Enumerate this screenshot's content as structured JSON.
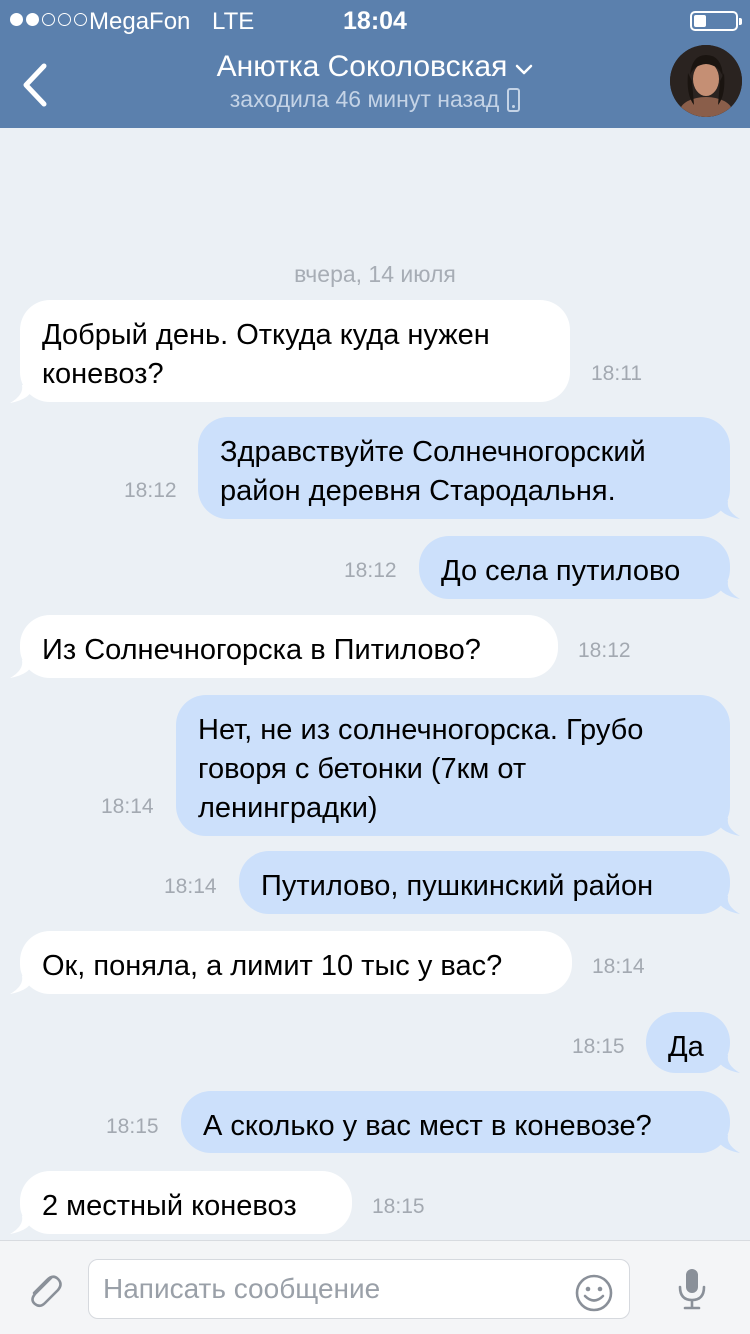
{
  "status_bar": {
    "signal_bars_filled": 2,
    "signal_bars_total": 5,
    "carrier": "MegaFon",
    "network": "LTE",
    "time": "18:04",
    "battery_level": 0.3
  },
  "header": {
    "contact_name": "Анютка Соколовская",
    "last_seen": "заходила 46 минут назад",
    "back_icon": "chevron-left-icon",
    "dropdown_icon": "chevron-down-icon",
    "device_icon": "mobile-phone-icon",
    "accent_color": "#5b80ad"
  },
  "chat": {
    "date_divider": "вчера, 14 июля",
    "incoming_color": "#ffffff",
    "outgoing_color": "#cce0fb",
    "messages": [
      {
        "direction": "in",
        "text": "Добрый день. Откуда куда нужен\nконевоз?",
        "time": "18:11"
      },
      {
        "direction": "out",
        "text": "Здравствуйте Солнечногорский\nрайон деревня Стародальня.",
        "time": "18:12"
      },
      {
        "direction": "out",
        "text": "До села путилово",
        "time": "18:12"
      },
      {
        "direction": "in",
        "text": "Из Солнечногорска в Питилово?",
        "time": "18:12"
      },
      {
        "direction": "out",
        "text": "Нет, не из солнечногорска. Грубо\nговоря с бетонки (7км от\nленинградки)",
        "time": "18:14"
      },
      {
        "direction": "out",
        "text": "Путилово, пушкинский район",
        "time": "18:14"
      },
      {
        "direction": "in",
        "text": "Ок, поняла, а лимит 10 тыс у вас?",
        "time": "18:14"
      },
      {
        "direction": "out",
        "text": "Да",
        "time": "18:15"
      },
      {
        "direction": "out",
        "text": "А сколько у вас мест в коневозе?",
        "time": "18:15"
      },
      {
        "direction": "in",
        "text": "2 местный коневоз",
        "time": "18:15"
      }
    ]
  },
  "input_bar": {
    "placeholder": "Написать сообщение",
    "value": "",
    "attach_icon": "paperclip-icon",
    "emoji_icon": "smiley-icon",
    "mic_icon": "microphone-icon"
  }
}
